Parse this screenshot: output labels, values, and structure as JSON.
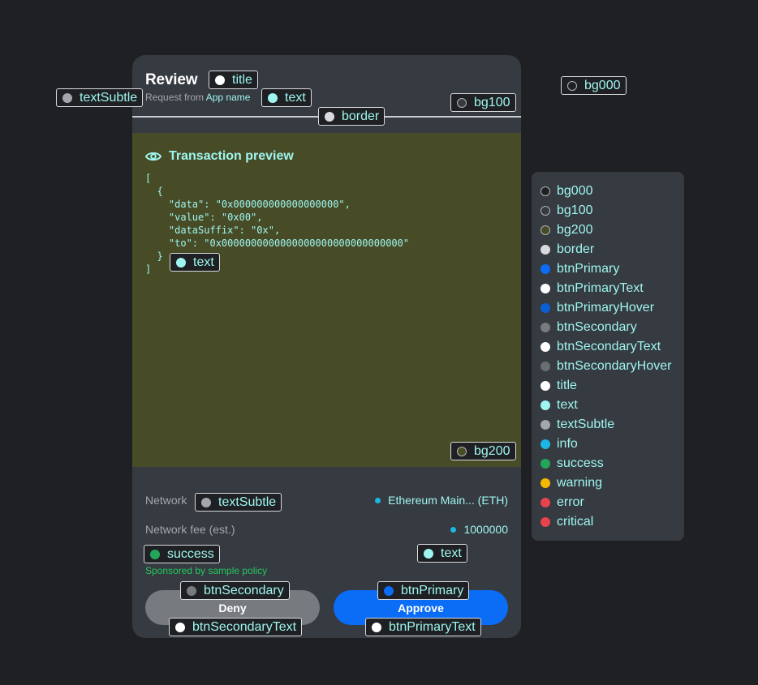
{
  "card": {
    "title": "Review",
    "subtitle_prefix": "Request from",
    "app_name": "App name",
    "preview_title": "Transaction preview",
    "preview_code": "[\n  {\n    \"data\": \"0x000000000000000000\",\n    \"value\": \"0x00\",\n    \"dataSuffix\": \"0x\",\n    \"to\": \"0x0000000000000000000000000000000\"\n  }\n]",
    "network_label": "Network",
    "network_value": "Ethereum Main... (ETH)",
    "fee_label": "Network fee (est.)",
    "fee_value": "1000000",
    "sponsor_text": "Sponsored by sample policy",
    "deny_label": "Deny",
    "approve_label": "Approve"
  },
  "tags": {
    "title": "title",
    "text_sub": "text",
    "text_subtle": "textSubtle",
    "border": "border",
    "bg100": "bg100",
    "bg000": "bg000",
    "text_code": "text",
    "bg200": "bg200",
    "text_subtle_row": "textSubtle",
    "success": "success",
    "text_fee": "text",
    "btn_secondary": "btnSecondary",
    "btn_primary": "btnPrimary",
    "btn_secondary_text": "btnSecondaryText",
    "btn_primary_text": "btnPrimaryText"
  },
  "legend": [
    {
      "label": "bg000",
      "color": "#1f2023"
    },
    {
      "label": "bg100",
      "color": "#363a41"
    },
    {
      "label": "bg200",
      "color": "#474c27"
    },
    {
      "label": "border",
      "color": "#d8dade"
    },
    {
      "label": "btnPrimary",
      "color": "#0b6cf5"
    },
    {
      "label": "btnPrimaryText",
      "color": "#ffffff"
    },
    {
      "label": "btnPrimaryHover",
      "color": "#0a5fd6"
    },
    {
      "label": "btnSecondary",
      "color": "#777b80"
    },
    {
      "label": "btnSecondaryText",
      "color": "#ffffff"
    },
    {
      "label": "btnSecondaryHover",
      "color": "#6a6e73"
    },
    {
      "label": "title",
      "color": "#ffffff"
    },
    {
      "label": "text",
      "color": "#9ff6f0"
    },
    {
      "label": "textSubtle",
      "color": "#a3a6ad"
    },
    {
      "label": "info",
      "color": "#1bb6e4"
    },
    {
      "label": "success",
      "color": "#23a65a"
    },
    {
      "label": "warning",
      "color": "#f5b800"
    },
    {
      "label": "error",
      "color": "#e5434d"
    },
    {
      "label": "critical",
      "color": "#e5434d"
    }
  ]
}
